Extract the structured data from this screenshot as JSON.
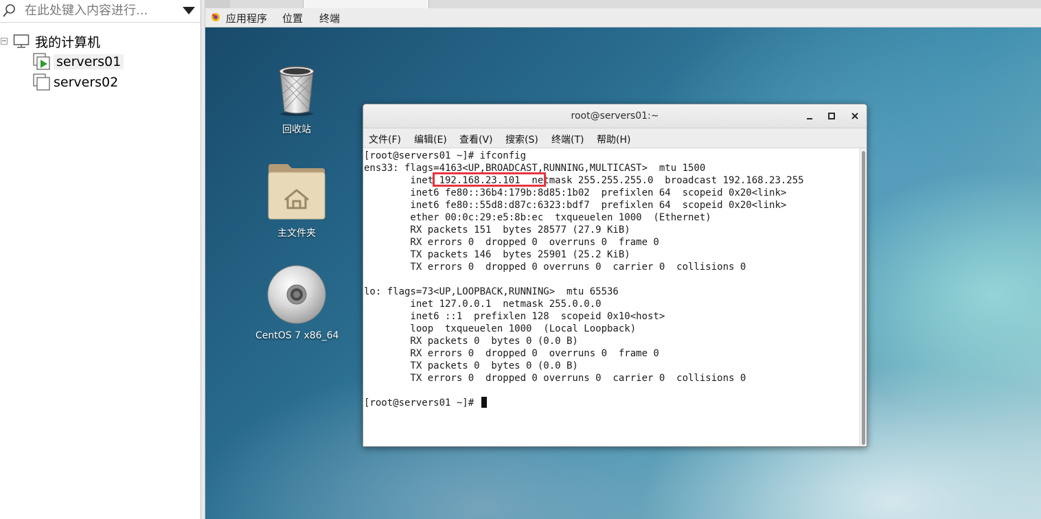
{
  "library": {
    "search_placeholder": "在此处键入内容进行...",
    "root_label": "我的计算机",
    "vms": [
      {
        "label": "servers01",
        "running": true
      },
      {
        "label": "servers02",
        "running": false
      }
    ]
  },
  "gnome_bar": {
    "applications": "应用程序",
    "places": "位置",
    "terminal": "终端"
  },
  "desktop": {
    "icons": [
      {
        "label": "回收站",
        "icon": "trash-icon"
      },
      {
        "label": "主文件夹",
        "icon": "home-folder-icon"
      },
      {
        "label": "CentOS 7 x86_64",
        "icon": "cd-disc-icon"
      }
    ]
  },
  "terminal": {
    "title": "root@servers01:~",
    "menu": [
      "文件(F)",
      "编辑(E)",
      "查看(V)",
      "搜索(S)",
      "终端(T)",
      "帮助(H)"
    ],
    "lines": [
      "[root@servers01 ~]# ifconfig",
      "ens33: flags=4163<UP,BROADCAST,RUNNING,MULTICAST>  mtu 1500",
      "        inet 192.168.23.101  netmask 255.255.255.0  broadcast 192.168.23.255",
      "        inet6 fe80::36b4:179b:8d85:1b02  prefixlen 64  scopeid 0x20<link>",
      "        inet6 fe80::55d8:d87c:6323:bdf7  prefixlen 64  scopeid 0x20<link>",
      "        ether 00:0c:29:e5:8b:ec  txqueuelen 1000  (Ethernet)",
      "        RX packets 151  bytes 28577 (27.9 KiB)",
      "        RX errors 0  dropped 0  overruns 0  frame 0",
      "        TX packets 146  bytes 25901 (25.2 KiB)",
      "        TX errors 0  dropped 0 overruns 0  carrier 0  collisions 0",
      "",
      "lo: flags=73<UP,LOOPBACK,RUNNING>  mtu 65536",
      "        inet 127.0.0.1  netmask 255.0.0.0",
      "        inet6 ::1  prefixlen 128  scopeid 0x10<host>",
      "        loop  txqueuelen 1000  (Local Loopback)",
      "        RX packets 0  bytes 0 (0.0 B)",
      "        RX errors 0  dropped 0  overruns 0  frame 0",
      "        TX packets 0  bytes 0 (0.0 B)",
      "        TX errors 0  dropped 0 overruns 0  carrier 0  collisions 0",
      "",
      "[root@servers01 ~]# "
    ],
    "highlight_color": "#e8343f"
  }
}
